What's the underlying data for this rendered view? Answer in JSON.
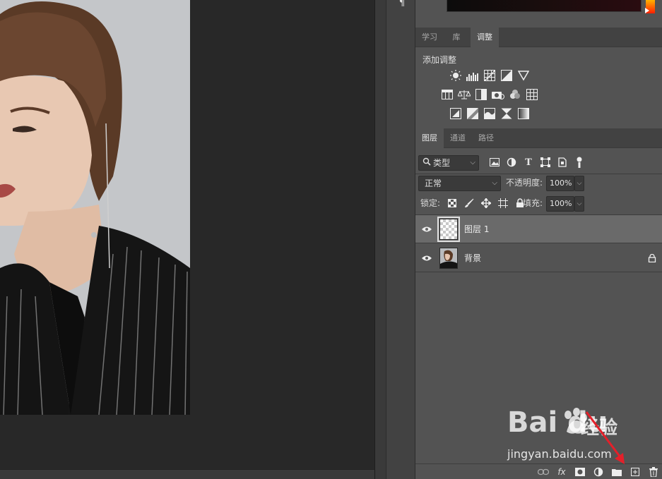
{
  "panel": {
    "top_tabs": [
      {
        "label": "学习"
      },
      {
        "label": "库"
      },
      {
        "label": "调整"
      }
    ],
    "adjustments": {
      "title": "添加调整",
      "row1": [
        "brightness-contrast-icon",
        "levels-icon",
        "curves-icon",
        "exposure-icon",
        "triangle-icon"
      ],
      "row2": [
        "vibrance-icon",
        "color-balance-icon",
        "black-white-icon",
        "photo-filter-icon",
        "channel-mixer-icon",
        "color-lookup-icon"
      ],
      "row3": [
        "invert-icon",
        "posterize-icon",
        "threshold-icon",
        "selective-color-icon",
        "gradient-map-icon"
      ]
    },
    "layer_tabs": [
      {
        "label": "图层"
      },
      {
        "label": "通道"
      },
      {
        "label": "路径"
      }
    ],
    "filter_label": "类型",
    "blend_mode": "正常",
    "opacity_label": "不透明度:",
    "opacity_value": "100%",
    "lock_label": "锁定:",
    "fill_label": "填充:",
    "fill_value": "100%",
    "layers": [
      {
        "name": "图层 1",
        "selected": true
      },
      {
        "name": "背景",
        "selected": false,
        "locked": true
      }
    ]
  },
  "watermark": {
    "logo": "Bai du",
    "text": "经验",
    "url": "jingyan.baidu.com"
  }
}
